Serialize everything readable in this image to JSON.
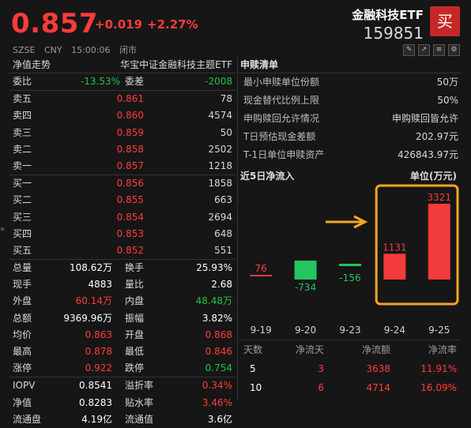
{
  "header": {
    "price": "0.857",
    "change": "+0.019",
    "change_pct": "+2.27%",
    "exchange": "SZSE",
    "currency": "CNY",
    "time": "15:00:06",
    "status": "闭市",
    "fund_name": "金融科技ETF",
    "fund_code": "159851",
    "buy_label": "买"
  },
  "left": {
    "title": "净值走势",
    "index_name": "华宝中证金融科技主题ETF",
    "weibi": {
      "label": "委比",
      "value": "-13.53%",
      "label2": "委差",
      "value2": "-2008"
    },
    "asks": [
      {
        "label": "卖五",
        "price": "0.861",
        "vol": "78"
      },
      {
        "label": "卖四",
        "price": "0.860",
        "vol": "4574"
      },
      {
        "label": "卖三",
        "price": "0.859",
        "vol": "50"
      },
      {
        "label": "卖二",
        "price": "0.858",
        "vol": "2502"
      },
      {
        "label": "卖一",
        "price": "0.857",
        "vol": "1218"
      }
    ],
    "bids": [
      {
        "label": "买一",
        "price": "0.856",
        "vol": "1858"
      },
      {
        "label": "买二",
        "price": "0.855",
        "vol": "663"
      },
      {
        "label": "买三",
        "price": "0.854",
        "vol": "2694"
      },
      {
        "label": "买四",
        "price": "0.853",
        "vol": "648"
      },
      {
        "label": "买五",
        "price": "0.852",
        "vol": "551"
      }
    ],
    "stats": [
      {
        "k1": "总量",
        "v1": "108.62万",
        "c1": "white",
        "k2": "换手",
        "v2": "25.93%",
        "c2": "white"
      },
      {
        "k1": "现手",
        "v1": "4883",
        "c1": "white",
        "k2": "量比",
        "v2": "2.68",
        "c2": "white"
      },
      {
        "k1": "外盘",
        "v1": "60.14万",
        "c1": "red",
        "k2": "内盘",
        "v2": "48.48万",
        "c2": "green"
      },
      {
        "k1": "总额",
        "v1": "9369.96万",
        "c1": "white",
        "k2": "振幅",
        "v2": "3.82%",
        "c2": "white"
      },
      {
        "k1": "均价",
        "v1": "0.863",
        "c1": "red",
        "k2": "开盘",
        "v2": "0.868",
        "c2": "red"
      },
      {
        "k1": "最高",
        "v1": "0.878",
        "c1": "red",
        "k2": "最低",
        "v2": "0.846",
        "c2": "red"
      },
      {
        "k1": "涨停",
        "v1": "0.922",
        "c1": "red",
        "k2": "跌停",
        "v2": "0.754",
        "c2": "green"
      }
    ],
    "iopv": [
      {
        "k1": "IOPV",
        "v1": "0.8541",
        "c1": "white",
        "k2": "溢折率",
        "v2": "0.34%",
        "c2": "red"
      },
      {
        "k1": "净值",
        "v1": "0.8283",
        "c1": "white",
        "k2": "贴水率",
        "v2": "3.46%",
        "c2": "red"
      },
      {
        "k1": "流通盘",
        "v1": "4.19亿",
        "c1": "white",
        "k2": "流通值",
        "v2": "3.6亿",
        "c2": "white"
      }
    ]
  },
  "subscription": {
    "title": "申赎清单",
    "rows": [
      {
        "k": "最小申赎单位份额",
        "v": "50万"
      },
      {
        "k": "现金替代比例上限",
        "v": "50%"
      },
      {
        "k": "申购赎回允许情况",
        "v": "申购赎回皆允许"
      },
      {
        "k": "T日预估现金差额",
        "v": "202.97元"
      },
      {
        "k": "T-1日单位申赎资产",
        "v": "426843.97元"
      }
    ]
  },
  "flow": {
    "title": "近5日净流入",
    "unit": "单位(万元)",
    "highlight_color": "#f5a623",
    "up_color": "#f23b3b",
    "down_color": "#22c55e"
  },
  "chart_data": {
    "type": "bar",
    "title": "近5日净流入",
    "ylabel": "单位(万元)",
    "categories": [
      "9-19",
      "9-20",
      "9-23",
      "9-24",
      "9-25"
    ],
    "values": [
      76,
      -734,
      -156,
      1131,
      3321
    ],
    "value_labels": [
      "76",
      "-734",
      "-156",
      "1131",
      "3321"
    ],
    "highlighted": [
      "9-24",
      "9-25"
    ]
  },
  "flow_stats": {
    "headers": [
      "天数",
      "净流天",
      "净流额",
      "净流率"
    ],
    "rows": [
      [
        "5",
        "3",
        "3638",
        "11.91%"
      ],
      [
        "10",
        "6",
        "4714",
        "16.09%"
      ]
    ]
  }
}
